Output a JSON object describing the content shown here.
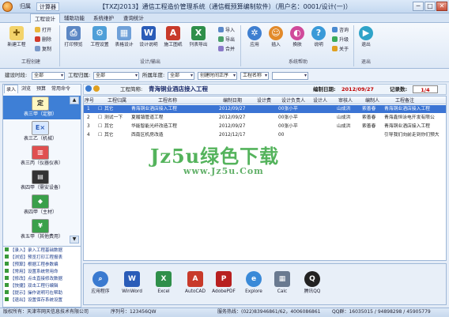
{
  "titlebar": {
    "quick_tabs": [
      "归属",
      "计算器"
    ],
    "title": "【TXZJ2013】通信工程造价管理系统（通信概预算编制软件）（用户名：0001/设计(一)）",
    "min": "─",
    "max": "□",
    "close": "✕"
  },
  "ribbon_tabs": [
    "工程设计",
    "辅助功能",
    "系统维护",
    "查询统计"
  ],
  "ribbon": {
    "groups": [
      "工程创建",
      "设计/输出",
      "系统帮助",
      "退出"
    ],
    "new_project": "新建工程",
    "open": "打开",
    "delete": "删除",
    "copy": "复制",
    "print_preview": "打印预览",
    "engineering_settings": "工程设置",
    "table_settings": "表格设计",
    "design_explain": "设计说明",
    "construct_explain": "施工图纸",
    "list_export": "列表导出",
    "import": "导入",
    "export": "导出",
    "merge": "合并",
    "app": "应用",
    "plugin": "插入",
    "switch": "换肤",
    "help": "说明",
    "consult": "咨询",
    "upgrade": "升级",
    "about": "关于",
    "exit": "退出"
  },
  "filters": {
    "labels": [
      "建设时段:",
      "工程归属:",
      "所属年度:",
      "创建时间正序",
      "工程名称"
    ],
    "values": [
      "全部",
      "全部",
      "全部"
    ]
  },
  "left_panel": {
    "tabs": [
      "录入",
      "浏览",
      "预算",
      "常用命令"
    ],
    "tables": [
      "表三甲（定额）",
      "表三乙（机械）",
      "表三丙（仪器仪表）",
      "表四甲（需安设备）",
      "表四甲（主材）",
      "表五甲（其他费用）"
    ],
    "tips": [
      "【录入】录入工程基础数据",
      "【浏览】预览打印工程报表",
      "【预算】根据工程参数编",
      "【常用】设置系统常用命",
      "【修改】点击直接修改数据",
      "【快捷】双击工程行编辑",
      "【提示】操作说明可在帮助",
      "【退出】设置保存系统设置"
    ]
  },
  "project_header": {
    "name_label": "工程简称:",
    "name": "青海铜业酒店接入工程",
    "date_label": "编制日期:",
    "date": "2012/09/27",
    "count_label": "记录数:",
    "page": "1/4"
  },
  "grid": {
    "columns": [
      "序号",
      "工程归属",
      "工程名称",
      "编制日期",
      "设计费",
      "设计负责人",
      "设计人",
      "审核人",
      "编制人",
      "工程备注"
    ],
    "rows": [
      [
        "1",
        "其它",
        "青海铜业酒店接入工程",
        "2012/09/27",
        "",
        "00张小平",
        "",
        "山成洪",
        "索善春",
        "青海铜业酒店接入工程"
      ],
      [
        "2",
        "测试一下",
        "夏履镇管道工程",
        "2012/09/27",
        "",
        "00张小平",
        "",
        "山成洪",
        "索善春",
        "青海鑫恒泳电开发有限公"
      ],
      [
        "3",
        "其它",
        "华能智能光纤改造工程",
        "2012/09/27",
        "",
        "00张小平",
        "",
        "山成洪",
        "索善春",
        "青海铜业酒店接入工程"
      ],
      [
        "4",
        "其它",
        "西南区机房改造",
        "2012/12/17",
        "",
        "00",
        "",
        "",
        "",
        "引导我们向前走到你们预大"
      ]
    ]
  },
  "watermark": {
    "line1": "Jz5u绿色下载",
    "line2": "www.Jz5u.Com"
  },
  "tools": [
    "应用程序",
    "WinWord",
    "Excel",
    "AutoCAD",
    "AdobePDF",
    "Explore",
    "Calc",
    "腾讯QQ"
  ],
  "status": {
    "copyright": "版权所有：天津市网天信息技术有限公司",
    "serial": "序列号：123456QW",
    "hotline": "服务热线：(022)83946861/62，4006086861",
    "qq": "QQ群：16035015 / 94898298 / 45905779"
  },
  "colors": {
    "accent": "#3b74d4",
    "watermark": "#2fa339",
    "title_red": "#c00000"
  }
}
